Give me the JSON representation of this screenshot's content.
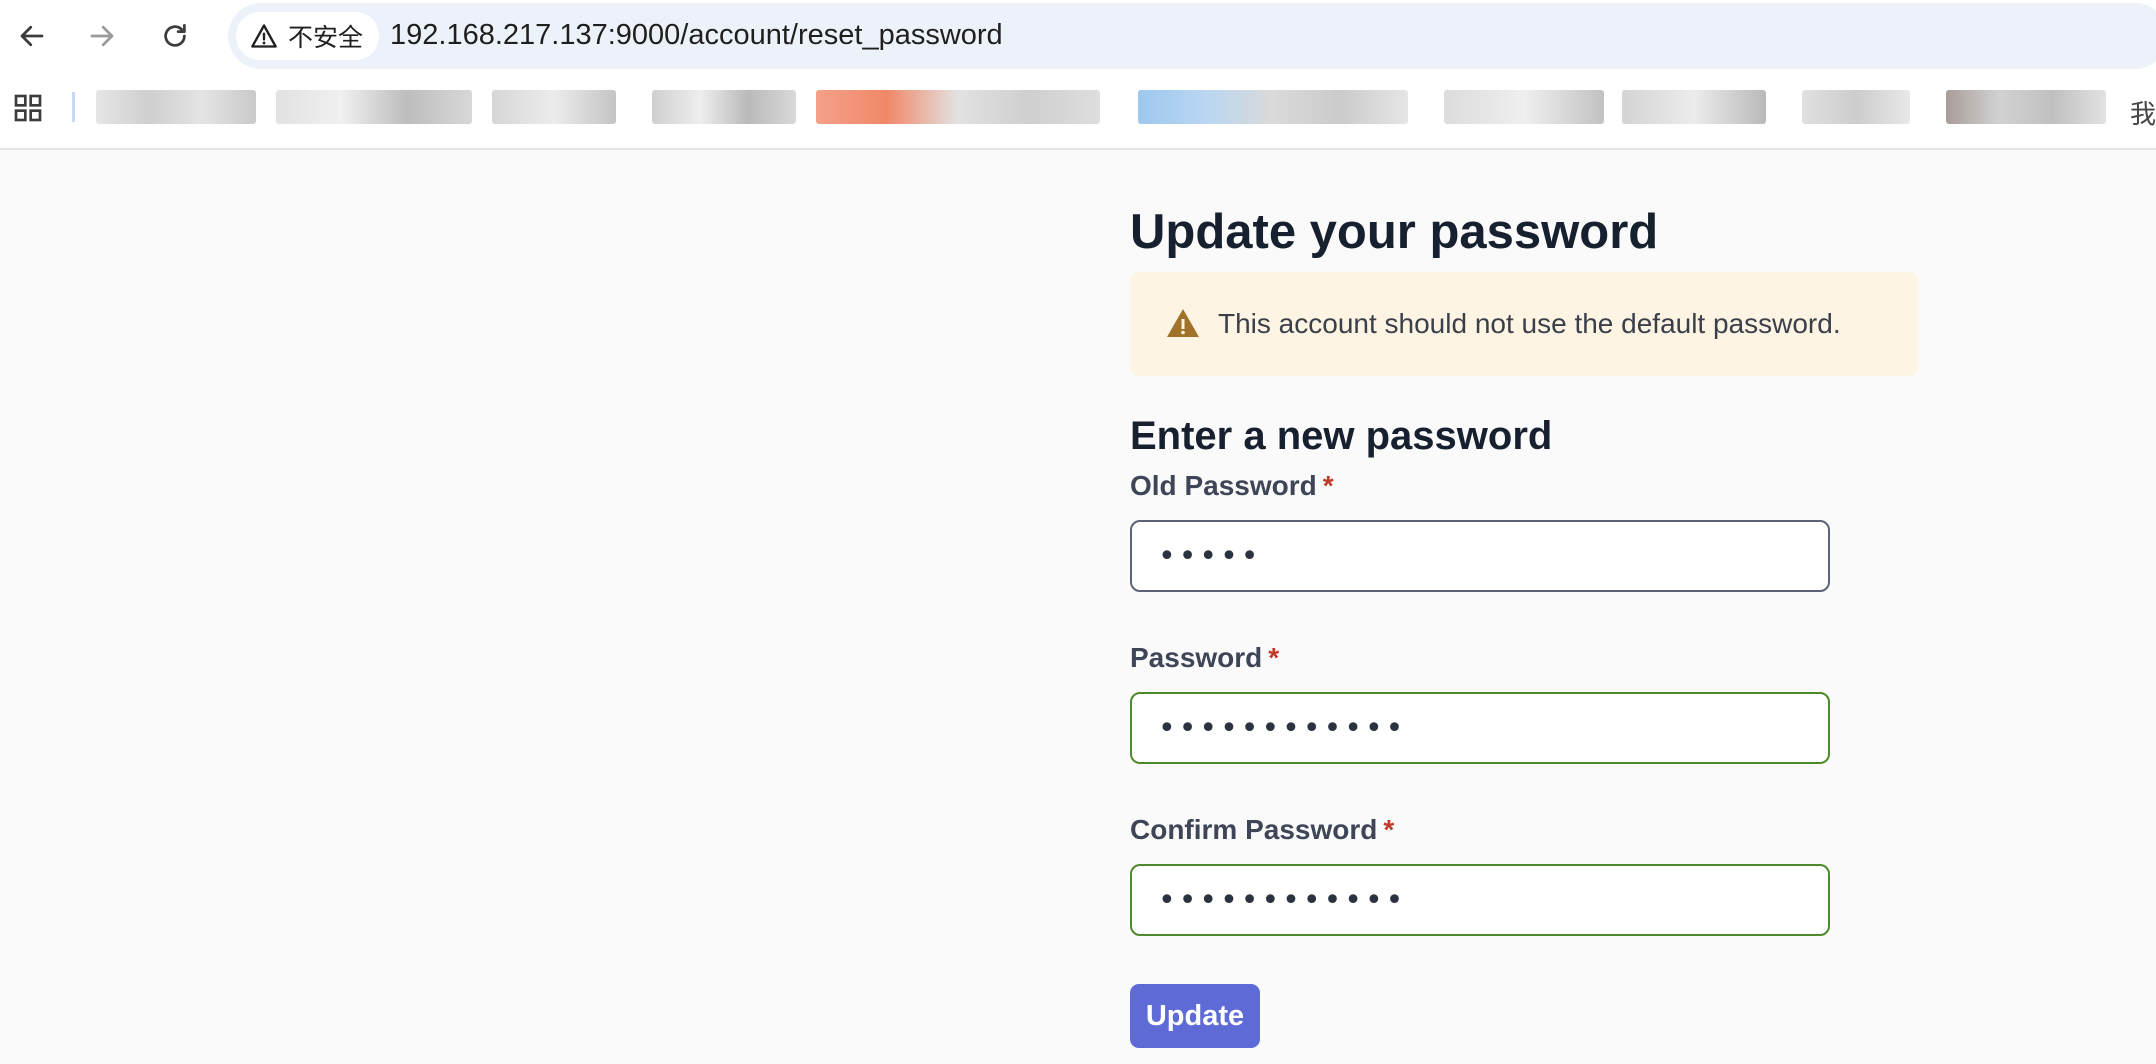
{
  "browser": {
    "security_label": "不安全",
    "url": "192.168.217.137:9000/account/reset_password",
    "partial_bookmark_glyph": "我"
  },
  "page": {
    "title": "Update your password",
    "alert": {
      "message": "This account should not use the default password.",
      "icon": "warning-triangle-icon",
      "color": "#a0722a"
    },
    "form": {
      "heading": "Enter a new password",
      "required_mark": "*",
      "fields": [
        {
          "label": "Old Password",
          "value": "•••••",
          "state": "neutral"
        },
        {
          "label": "Password",
          "value": "••••••••••••",
          "state": "valid"
        },
        {
          "label": "Confirm Password",
          "value": "••••••••••••",
          "state": "valid"
        }
      ],
      "submit_label": "Update"
    }
  },
  "colors": {
    "accent": "#5e6bd7",
    "valid_border": "#4d8a2a",
    "required": "#c0392b",
    "alert_bg": "#fdf4e3"
  }
}
